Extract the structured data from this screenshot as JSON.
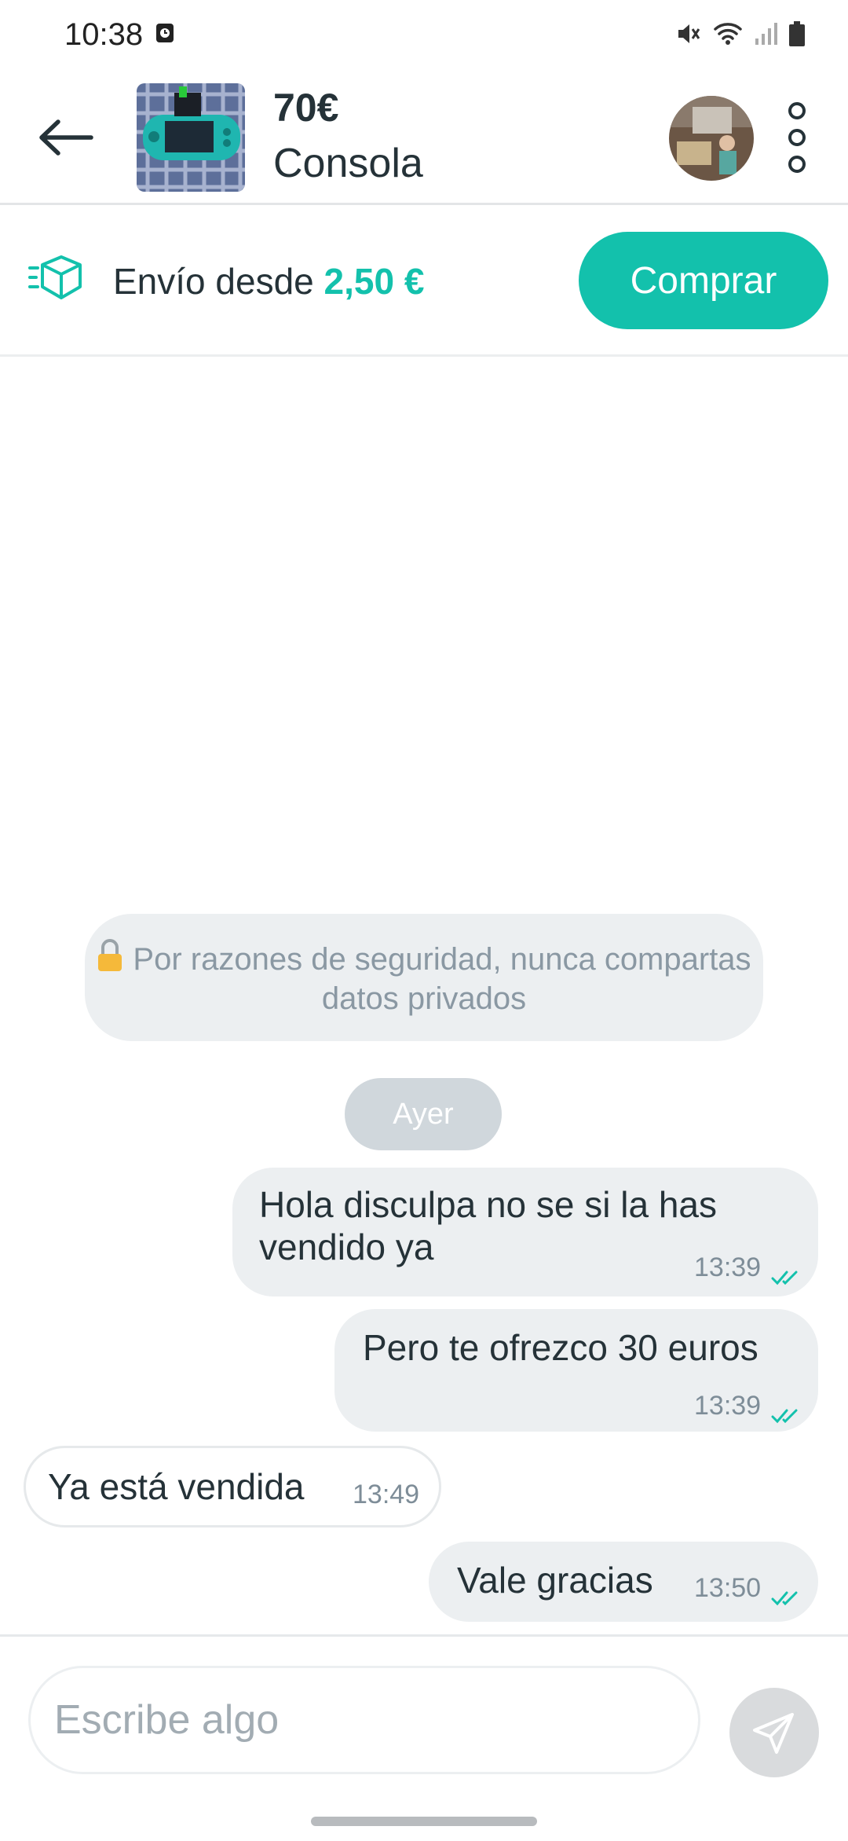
{
  "status_bar": {
    "time": "10:38"
  },
  "header": {
    "price": "70€",
    "product_name": "Consola"
  },
  "shipping": {
    "label": "Envío desde ",
    "price": "2,50 €",
    "buy_label": "Comprar"
  },
  "security_note": "Por razones de seguridad, nunca compartas datos privados",
  "day_chip": "Ayer",
  "messages": [
    {
      "direction": "out",
      "text": "Hola disculpa no se si la has vendido ya",
      "time": "13:39",
      "read": true
    },
    {
      "direction": "out",
      "text": "Pero te ofrezco 30 euros",
      "time": "13:39",
      "read": true
    },
    {
      "direction": "in",
      "text": "Ya está vendida",
      "time": "13:49"
    },
    {
      "direction": "out",
      "text": "Vale gracias",
      "time": "13:50",
      "read": true
    }
  ],
  "input": {
    "placeholder": "Escribe algo"
  },
  "colors": {
    "accent": "#13c1ac",
    "bubble_out": "#eceff1",
    "text": "#253238"
  }
}
